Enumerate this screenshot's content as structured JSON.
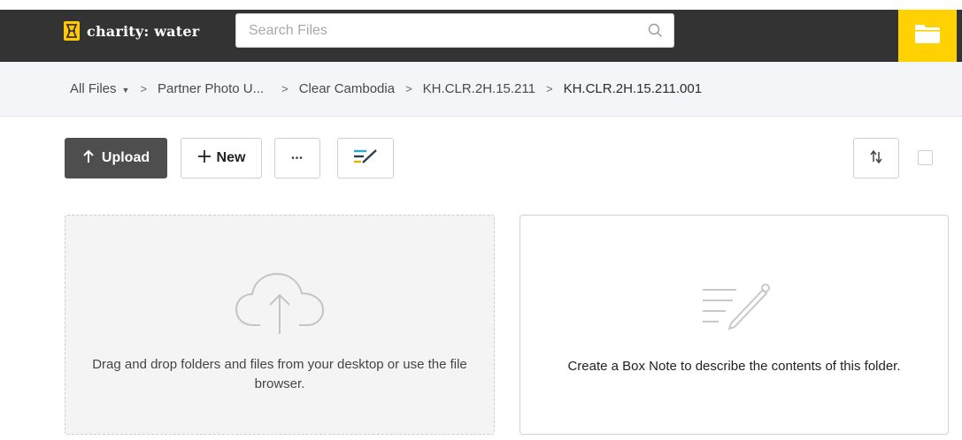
{
  "header": {
    "brand_name": "charity: water",
    "search_placeholder": "Search Files",
    "icons": {
      "logo": "jerrycan-logo-icon",
      "search": "search-icon",
      "folder": "folder-icon"
    },
    "accent_color": "#ffd100",
    "bar_color": "#333333"
  },
  "breadcrumb": {
    "items": [
      "All Files",
      "Partner Photo U...",
      "Clear Cambodia",
      "KH.CLR.2H.15.211",
      "KH.CLR.2H.15.211.001"
    ],
    "separator": ">"
  },
  "toolbar": {
    "upload_label": "Upload",
    "new_label": "New",
    "more_label": "•••",
    "icons": {
      "upload": "arrow-up-icon",
      "new": "plus-icon",
      "note": "box-note-icon",
      "sort": "sort-icon"
    }
  },
  "dropzone": {
    "text": "Drag and drop folders and files from your desktop or use the file browser.",
    "icon": "cloud-upload-icon"
  },
  "note_card": {
    "text": "Create a Box Note to describe the contents of this folder.",
    "icon": "note-pencil-icon"
  }
}
